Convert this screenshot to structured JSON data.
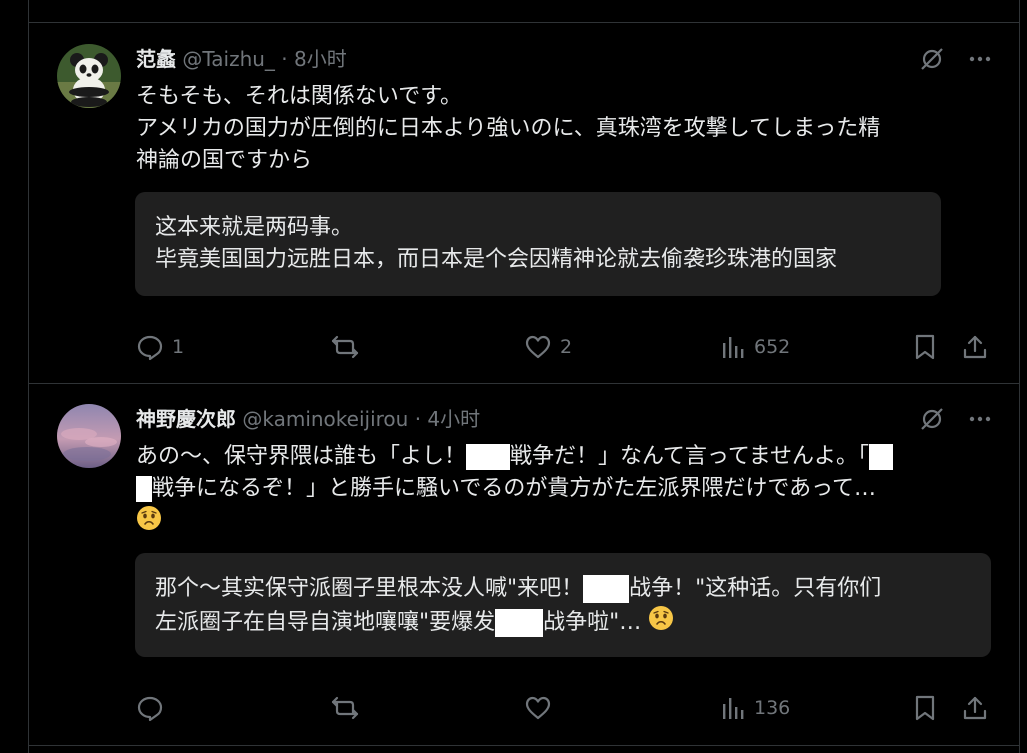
{
  "tweets": [
    {
      "name": "范蠡",
      "handle": "@Taizhu_",
      "dot": "·",
      "time": "8小时",
      "text_lines": [
        "そもそも、それは関係ないです。",
        "アメリカの国力が圧倒的に日本より強いのに、真珠湾を攻撃してしまった精",
        "神論の国ですから"
      ],
      "translation_lines": [
        "这本来就是两码事。",
        "毕竟美国国力远胜日本，而日本是个会因精神论就去偷袭珍珠港的国家"
      ],
      "replies": "1",
      "retweets": "",
      "likes": "2",
      "views": "652"
    },
    {
      "name": "神野慶次郎",
      "handle": "@kaminokeijirou",
      "dot": "·",
      "time": "4小时",
      "text_line1_a": "あの～、保守界隈は誰も「よし！",
      "text_line1_b": "戦争だ！」なんて言ってませんよ。「",
      "text_line2": "戦争になるぞ！」と勝手に騒いでるのが貴方がた左派界隈だけであって…",
      "translation_line1_a": "那个～其实保守派圈子里根本没人喊\"来吧！",
      "translation_line1_b": "战争！\"这种话。只有你们",
      "translation_line2_a": "左派圈子在自导自演地嚷嚷\"要爆发",
      "translation_line2_b": "战争啦\"…",
      "replies": "",
      "retweets": "",
      "likes": "",
      "views": "136"
    }
  ],
  "icons": {
    "grok": "grok-slash-icon",
    "more": "more-dots-icon",
    "reply": "reply-bubble-icon",
    "retweet": "retweet-icon",
    "like": "heart-icon",
    "views": "bar-chart-icon",
    "bookmark": "bookmark-icon",
    "share": "share-upload-icon"
  },
  "colors": {
    "background": "#000000",
    "text": "#e7e9ea",
    "muted": "#71767b",
    "divider": "#2f3336",
    "translation_box": "#202020"
  }
}
